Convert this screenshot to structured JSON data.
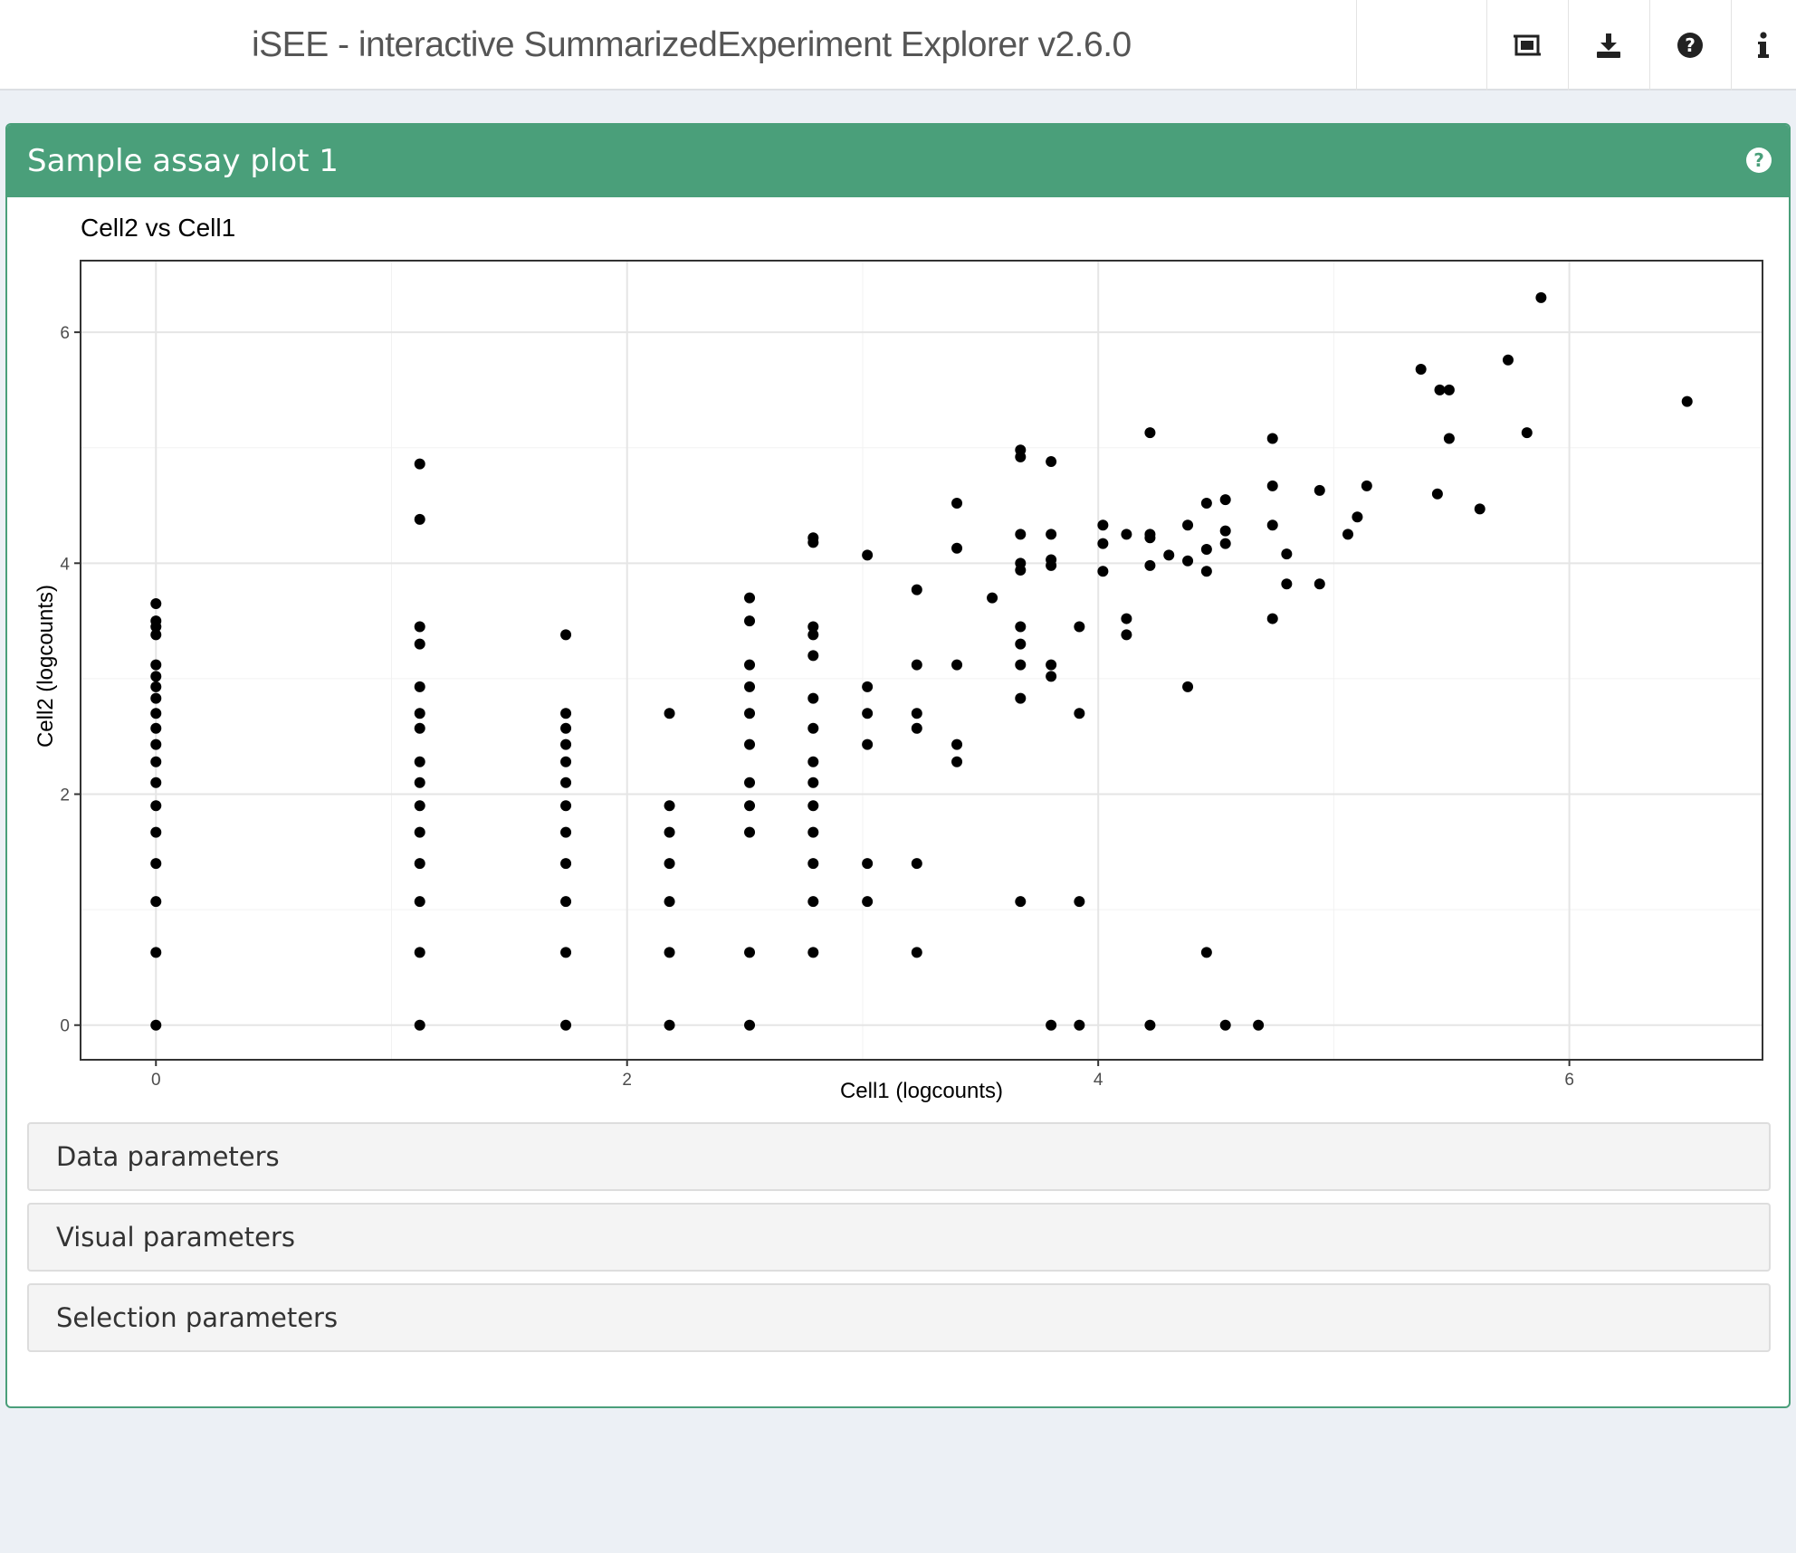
{
  "header": {
    "app_title": "iSEE - interactive SummarizedExperiment Explorer v2.6.0",
    "icons": [
      "screenshot-icon",
      "download-icon",
      "question-circle-icon",
      "info-icon"
    ]
  },
  "panel": {
    "title": "Sample assay plot 1",
    "color": "#4a9f7a",
    "help_icon": "question-circle-icon",
    "sections": [
      {
        "label": "Data parameters"
      },
      {
        "label": "Visual parameters"
      },
      {
        "label": "Selection parameters"
      }
    ]
  },
  "chart_data": {
    "type": "scatter",
    "title": "Cell2 vs Cell1",
    "xlabel": "Cell1 (logcounts)",
    "ylabel": "Cell2 (logcounts)",
    "xlim": [
      -0.32,
      6.82
    ],
    "ylim": [
      -0.3,
      6.62
    ],
    "xticks": [
      0,
      2,
      4,
      6
    ],
    "yticks": [
      0,
      2,
      4,
      6
    ],
    "grid": true,
    "point_color": "#000000",
    "points": [
      [
        0,
        0
      ],
      [
        0,
        0.63
      ],
      [
        0,
        1.07
      ],
      [
        0,
        1.4
      ],
      [
        0,
        1.67
      ],
      [
        0,
        1.9
      ],
      [
        0,
        2.1
      ],
      [
        0,
        2.28
      ],
      [
        0,
        2.43
      ],
      [
        0,
        2.57
      ],
      [
        0,
        2.7
      ],
      [
        0,
        2.83
      ],
      [
        0,
        2.93
      ],
      [
        0,
        3.02
      ],
      [
        0,
        3.12
      ],
      [
        0,
        3.38
      ],
      [
        0,
        3.45
      ],
      [
        0,
        3.5
      ],
      [
        0,
        3.65
      ],
      [
        1.12,
        0
      ],
      [
        1.12,
        0.63
      ],
      [
        1.12,
        1.07
      ],
      [
        1.12,
        1.4
      ],
      [
        1.12,
        1.67
      ],
      [
        1.12,
        1.9
      ],
      [
        1.12,
        2.1
      ],
      [
        1.12,
        2.28
      ],
      [
        1.12,
        2.57
      ],
      [
        1.12,
        2.7
      ],
      [
        1.12,
        2.93
      ],
      [
        1.12,
        3.3
      ],
      [
        1.12,
        3.45
      ],
      [
        1.12,
        4.38
      ],
      [
        1.12,
        4.86
      ],
      [
        1.74,
        0
      ],
      [
        1.74,
        0.63
      ],
      [
        1.74,
        1.07
      ],
      [
        1.74,
        1.4
      ],
      [
        1.74,
        1.67
      ],
      [
        1.74,
        1.9
      ],
      [
        1.74,
        2.1
      ],
      [
        1.74,
        2.28
      ],
      [
        1.74,
        2.43
      ],
      [
        1.74,
        2.57
      ],
      [
        1.74,
        2.7
      ],
      [
        1.74,
        3.38
      ],
      [
        2.18,
        0
      ],
      [
        2.18,
        0.63
      ],
      [
        2.18,
        1.07
      ],
      [
        2.18,
        1.4
      ],
      [
        2.18,
        1.67
      ],
      [
        2.18,
        1.9
      ],
      [
        2.18,
        2.7
      ],
      [
        2.52,
        0
      ],
      [
        2.52,
        0.63
      ],
      [
        2.52,
        1.67
      ],
      [
        2.52,
        1.9
      ],
      [
        2.52,
        2.1
      ],
      [
        2.52,
        2.43
      ],
      [
        2.52,
        2.7
      ],
      [
        2.52,
        2.93
      ],
      [
        2.52,
        3.12
      ],
      [
        2.52,
        3.5
      ],
      [
        2.52,
        3.7
      ],
      [
        2.79,
        0.63
      ],
      [
        2.79,
        1.07
      ],
      [
        2.79,
        1.4
      ],
      [
        2.79,
        1.67
      ],
      [
        2.79,
        1.9
      ],
      [
        2.79,
        2.1
      ],
      [
        2.79,
        2.28
      ],
      [
        2.79,
        2.57
      ],
      [
        2.79,
        2.83
      ],
      [
        2.79,
        3.2
      ],
      [
        2.79,
        3.38
      ],
      [
        2.79,
        3.45
      ],
      [
        2.79,
        4.18
      ],
      [
        2.79,
        4.22
      ],
      [
        3.02,
        1.07
      ],
      [
        3.02,
        1.4
      ],
      [
        3.02,
        2.43
      ],
      [
        3.02,
        2.7
      ],
      [
        3.02,
        2.93
      ],
      [
        3.02,
        4.07
      ],
      [
        3.23,
        0.63
      ],
      [
        3.23,
        1.4
      ],
      [
        3.23,
        2.57
      ],
      [
        3.23,
        2.7
      ],
      [
        3.23,
        3.12
      ],
      [
        3.23,
        3.77
      ],
      [
        3.4,
        2.28
      ],
      [
        3.4,
        2.43
      ],
      [
        3.4,
        3.12
      ],
      [
        3.4,
        4.13
      ],
      [
        3.4,
        4.52
      ],
      [
        3.55,
        3.7
      ],
      [
        3.67,
        1.07
      ],
      [
        3.67,
        2.83
      ],
      [
        3.67,
        3.12
      ],
      [
        3.67,
        3.3
      ],
      [
        3.67,
        3.45
      ],
      [
        3.67,
        3.94
      ],
      [
        3.67,
        4.0
      ],
      [
        3.67,
        4.25
      ],
      [
        3.67,
        4.92
      ],
      [
        3.67,
        4.98
      ],
      [
        3.8,
        0
      ],
      [
        3.8,
        3.02
      ],
      [
        3.8,
        3.12
      ],
      [
        3.8,
        3.98
      ],
      [
        3.8,
        4.03
      ],
      [
        3.8,
        4.25
      ],
      [
        3.8,
        4.88
      ],
      [
        3.92,
        0
      ],
      [
        3.92,
        1.07
      ],
      [
        3.92,
        2.7
      ],
      [
        3.92,
        3.45
      ],
      [
        4.02,
        3.93
      ],
      [
        4.02,
        4.17
      ],
      [
        4.02,
        4.33
      ],
      [
        4.12,
        3.38
      ],
      [
        4.12,
        3.52
      ],
      [
        4.12,
        4.25
      ],
      [
        4.22,
        0
      ],
      [
        4.22,
        3.98
      ],
      [
        4.22,
        4.22
      ],
      [
        4.22,
        4.25
      ],
      [
        4.22,
        5.13
      ],
      [
        4.3,
        4.07
      ],
      [
        4.38,
        2.93
      ],
      [
        4.38,
        4.02
      ],
      [
        4.38,
        4.33
      ],
      [
        4.46,
        0.63
      ],
      [
        4.46,
        3.93
      ],
      [
        4.46,
        4.12
      ],
      [
        4.46,
        4.52
      ],
      [
        4.54,
        0
      ],
      [
        4.54,
        4.17
      ],
      [
        4.54,
        4.28
      ],
      [
        4.54,
        4.55
      ],
      [
        4.68,
        0
      ],
      [
        4.74,
        3.52
      ],
      [
        4.74,
        4.33
      ],
      [
        4.74,
        4.67
      ],
      [
        4.74,
        5.08
      ],
      [
        4.8,
        3.82
      ],
      [
        4.8,
        4.08
      ],
      [
        4.94,
        3.82
      ],
      [
        4.94,
        4.63
      ],
      [
        5.06,
        4.25
      ],
      [
        5.1,
        4.4
      ],
      [
        5.14,
        4.67
      ],
      [
        5.37,
        5.68
      ],
      [
        5.44,
        4.6
      ],
      [
        5.45,
        5.5
      ],
      [
        5.49,
        5.08
      ],
      [
        5.49,
        5.5
      ],
      [
        5.62,
        4.47
      ],
      [
        5.74,
        5.76
      ],
      [
        5.82,
        5.13
      ],
      [
        5.88,
        6.3
      ],
      [
        6.5,
        5.4
      ]
    ]
  }
}
